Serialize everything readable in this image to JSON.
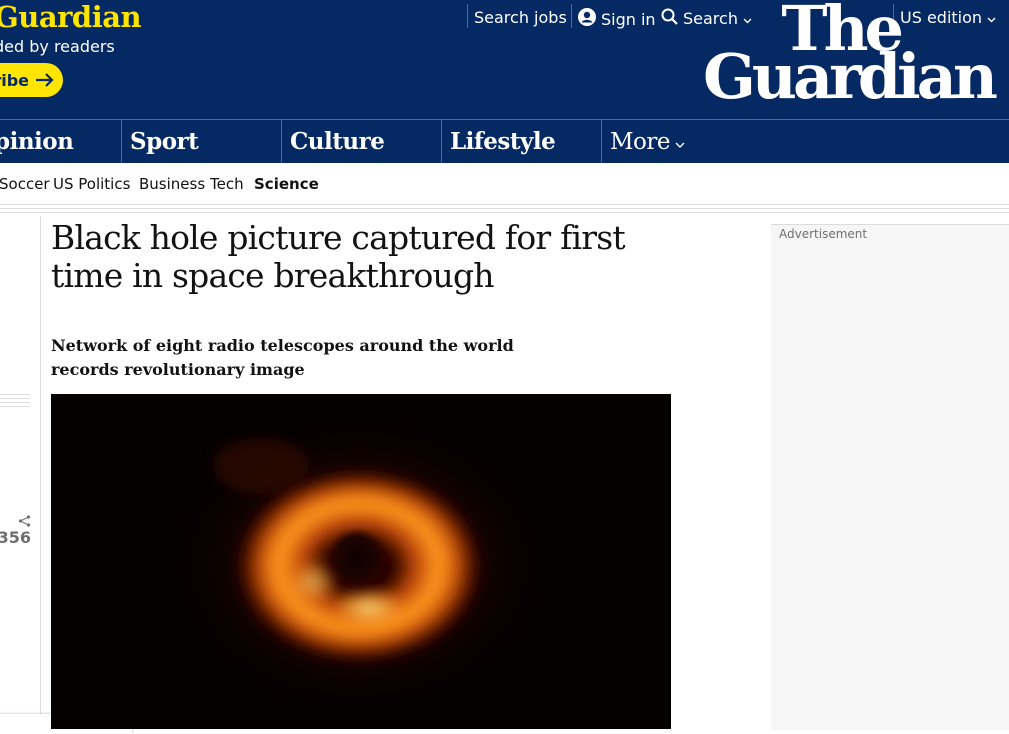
{
  "header": {
    "support_title": "Guardian",
    "support_sub": "ded by readers",
    "subscribe_label": "ribe",
    "top_links": {
      "search_jobs": "Search jobs",
      "sign_in": "Sign in",
      "search": "Search",
      "edition": "US edition"
    },
    "logo_line1": "The",
    "logo_line2": "Guardian"
  },
  "pillars": [
    "pinion",
    "Sport",
    "Culture",
    "Lifestyle",
    "More"
  ],
  "subnav": [
    "Soccer",
    "US Politics",
    "Business",
    "Tech",
    "Science"
  ],
  "subnav_active": "Science",
  "meta": {
    "share_count": ",356"
  },
  "article": {
    "headline": "Black hole picture captured for first time in space breakthrough",
    "standfirst": "Network of eight radio telescopes around the world records revolutionary image"
  },
  "ad": {
    "label": "Advertisement"
  },
  "colors": {
    "brand_blue": "#052962",
    "brand_yellow": "#ffe500",
    "divider": "#506991"
  },
  "icons": [
    "arrow-right-icon",
    "user-icon",
    "search-icon",
    "chevron-down-icon",
    "share-icon"
  ]
}
